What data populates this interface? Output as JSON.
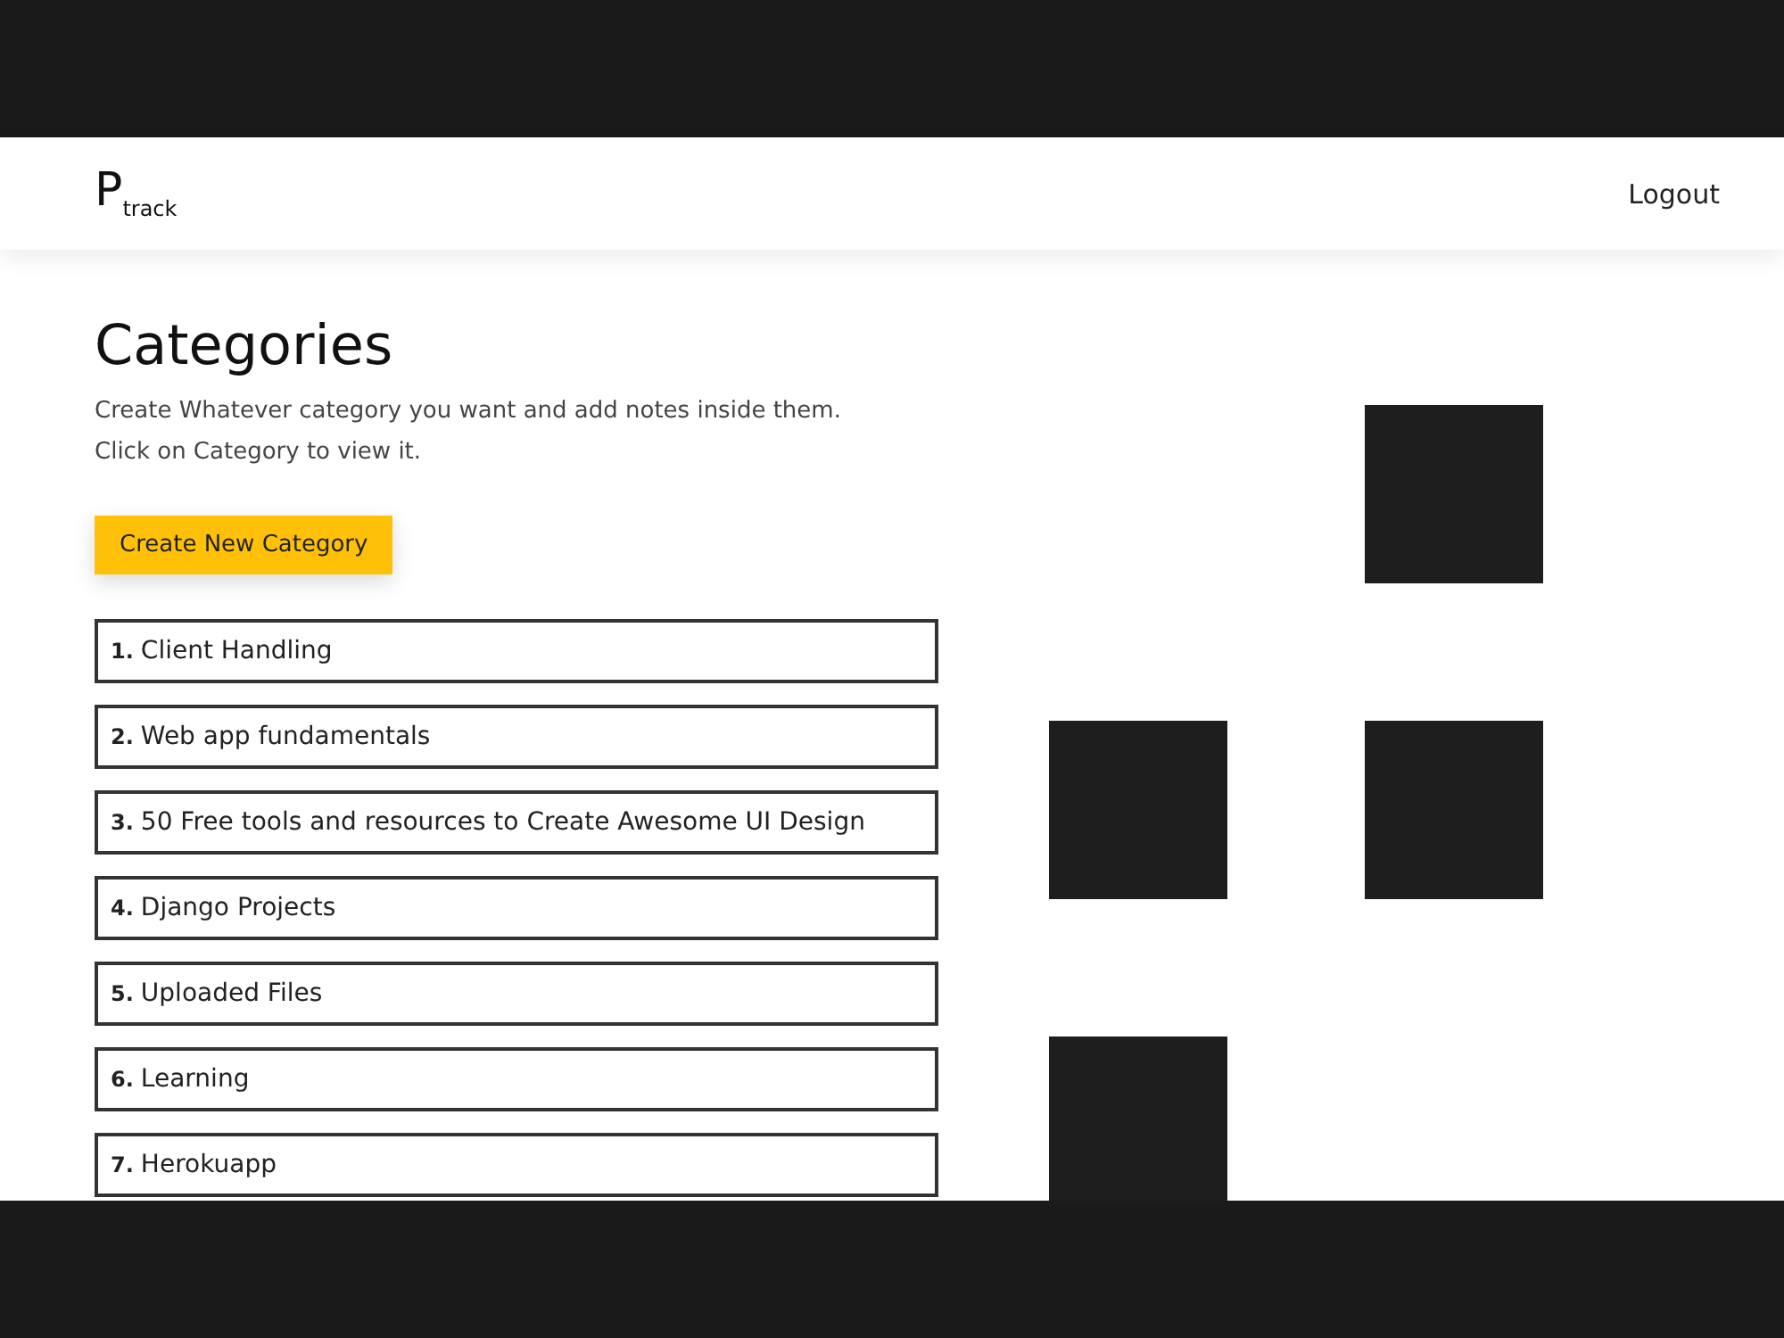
{
  "header": {
    "logo": "P$_{track}$",
    "logout": "Logout"
  },
  "page": {
    "title": "Categories",
    "description": [
      "Create Whatever category you want and add notes inside them.",
      "Click on Category to view it."
    ],
    "create_button": "Create New Category"
  },
  "categories": [
    {
      "number": "1.",
      "name": "Client Handling"
    },
    {
      "number": "2.",
      "name": "Web app fundamentals"
    },
    {
      "number": "3.",
      "name": "50 Free tools and resources to Create Awesome UI Design"
    },
    {
      "number": "4.",
      "name": "Django Projects"
    },
    {
      "number": "5.",
      "name": "Uploaded Files"
    },
    {
      "number": "6.",
      "name": "Learning"
    },
    {
      "number": "7.",
      "name": "Herokuapp"
    }
  ]
}
